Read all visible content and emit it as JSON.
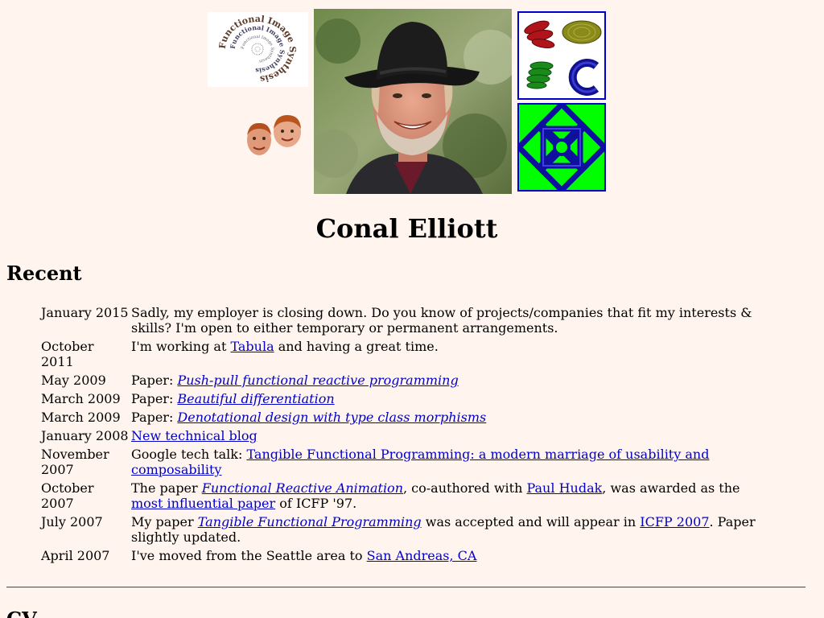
{
  "page": {
    "title": "Conal Elliott"
  },
  "banner": {
    "spiral_text": "Functional Image Synthesis",
    "icons": [
      "spiral-text-image",
      "kids-faces-image",
      "portrait-photo",
      "3d-shapes-image",
      "knot-pattern-image"
    ]
  },
  "sections": {
    "recent_heading": "Recent",
    "cv_heading": "CV"
  },
  "recent": [
    {
      "date": "January 2015",
      "parts": [
        {
          "text": "Sadly, my employer is closing down. Do you know of projects/companies that fit my interests & skills? I'm open to either temporary or permanent arrangements."
        }
      ]
    },
    {
      "date": "October 2011",
      "parts": [
        {
          "text": "I'm working at "
        },
        {
          "text": "Tabula",
          "link": true
        },
        {
          "text": " and having a great time."
        }
      ]
    },
    {
      "date": "May 2009",
      "parts": [
        {
          "text": "Paper: "
        },
        {
          "text": "Push-pull functional reactive programming",
          "link": true,
          "italic": true
        }
      ]
    },
    {
      "date": "March 2009",
      "parts": [
        {
          "text": "Paper: "
        },
        {
          "text": "Beautiful differentiation",
          "link": true,
          "italic": true
        }
      ]
    },
    {
      "date": "March 2009",
      "parts": [
        {
          "text": "Paper: "
        },
        {
          "text": "Denotational design with type class morphisms",
          "link": true,
          "italic": true
        }
      ]
    },
    {
      "date": "January 2008",
      "parts": [
        {
          "text": "New technical blog",
          "link": true
        }
      ]
    },
    {
      "date": "November 2007",
      "parts": [
        {
          "text": "Google tech talk: "
        },
        {
          "text": "Tangible Functional Programming: a modern marriage of usability and composability",
          "link": true
        }
      ]
    },
    {
      "date": "October 2007",
      "parts": [
        {
          "text": "The paper "
        },
        {
          "text": "Functional Reactive Animation",
          "link": true,
          "italic": true
        },
        {
          "text": ", co-authored with "
        },
        {
          "text": "Paul Hudak",
          "link": true
        },
        {
          "text": ", was awarded as the "
        },
        {
          "text": "most influential paper",
          "link": true
        },
        {
          "text": " of ICFP '97."
        }
      ]
    },
    {
      "date": "July 2007",
      "parts": [
        {
          "text": "My paper "
        },
        {
          "text": "Tangible Functional Programming",
          "link": true,
          "italic": true
        },
        {
          "text": " was accepted and will appear in "
        },
        {
          "text": "ICFP 2007",
          "link": true
        },
        {
          "text": ". Paper slightly updated."
        }
      ]
    },
    {
      "date": "April 2007",
      "parts": [
        {
          "text": "I've moved from the Seattle area to "
        },
        {
          "text": "San Andreas, CA",
          "link": true
        }
      ]
    }
  ]
}
